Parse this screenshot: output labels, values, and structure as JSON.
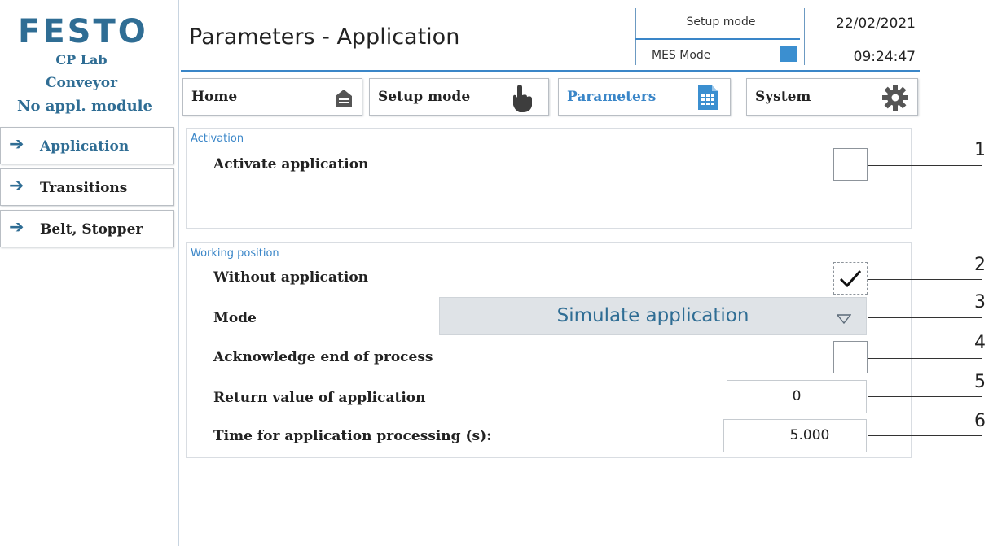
{
  "brand": {
    "logo_text": "FESTO",
    "line1": "CP Lab",
    "line2": "Conveyor",
    "line3": "No appl. module"
  },
  "header": {
    "title": "Parameters - Application",
    "setup_mode": "Setup mode",
    "mes_mode": "MES Mode",
    "date": "22/02/2021",
    "time": "09:24:47"
  },
  "nav": {
    "home": "Home",
    "setup_mode": "Setup mode",
    "parameters": "Parameters",
    "system": "System"
  },
  "sidebar": {
    "items": [
      {
        "label": "Application"
      },
      {
        "label": "Transitions"
      },
      {
        "label": "Belt, Stopper"
      }
    ]
  },
  "activation": {
    "group_title": "Activation",
    "activate_label": "Activate application",
    "activate_checked": false
  },
  "working": {
    "group_title": "Working position",
    "without_label": "Without application",
    "without_checked": true,
    "mode_label": "Mode",
    "mode_value": "Simulate application",
    "ack_label": "Acknowledge end of process",
    "ack_checked": false,
    "return_label": "Return value of application",
    "return_value": "0",
    "time_label": "Time for application processing (s):",
    "time_value": "5.000"
  },
  "callouts": [
    "1",
    "2",
    "3",
    "4",
    "5",
    "6"
  ],
  "colors": {
    "accent": "#3a86c8",
    "brand_blue": "#2f6d94",
    "mes_indicator": "#3b8fd0"
  }
}
